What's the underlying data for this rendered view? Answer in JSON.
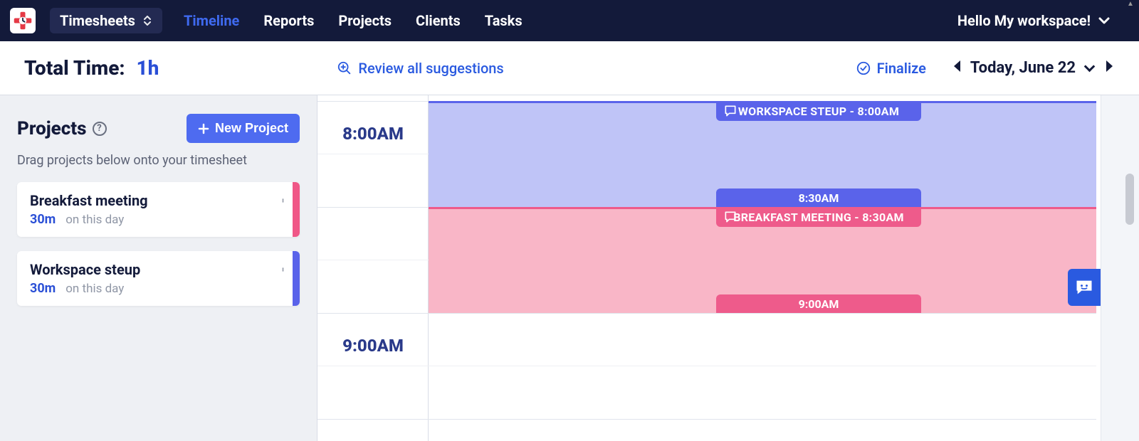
{
  "nav": {
    "primary": "Timesheets",
    "tabs": [
      "Timeline",
      "Reports",
      "Projects",
      "Clients",
      "Tasks"
    ],
    "active_tab": 0,
    "workspace_greeting": "Hello My workspace!"
  },
  "summary": {
    "total_label": "Total Time:",
    "total_value": "1h",
    "review_label": "Review all suggestions",
    "finalize_label": "Finalize",
    "date_label": "Today, June 22"
  },
  "sidebar": {
    "title": "Projects",
    "hint": "Drag projects below onto your timesheet",
    "new_button": "New Project",
    "projects": [
      {
        "name": "Breakfast meeting",
        "duration": "30m",
        "day": "on this day",
        "color": "#f05787"
      },
      {
        "name": "Workspace steup",
        "duration": "30m",
        "day": "on this day",
        "color": "#5a63ea"
      }
    ]
  },
  "timeline": {
    "hour_labels": [
      "8:00AM",
      "9:00AM"
    ],
    "blocks": [
      {
        "title": "WORKSPACE STEUP - 8:00AM",
        "end_label": "8:30AM",
        "start": "8:00AM",
        "end": "8:30AM",
        "color": "purple"
      },
      {
        "title": "BREAKFAST MEETING - 8:30AM",
        "end_label": "9:00AM",
        "start": "8:30AM",
        "end": "9:00AM",
        "color": "pink"
      }
    ]
  },
  "icons": {
    "logo": "clock-plus-icon",
    "help": "help-circle-icon",
    "plus": "plus-icon",
    "magnify_plus": "magnify-plus-icon",
    "check_circle": "check-circle-icon",
    "chevron_left": "chevron-left-icon",
    "chevron_right": "chevron-right-icon",
    "chevron_down": "chevron-down-icon",
    "chat": "chat-smile-icon",
    "comment": "comment-bubble-icon",
    "kebab": "kebab-icon"
  },
  "colors": {
    "navy": "#131a3a",
    "accent": "#2a5ae0",
    "purple": "#5a63ea",
    "pink": "#ee5b8b"
  }
}
